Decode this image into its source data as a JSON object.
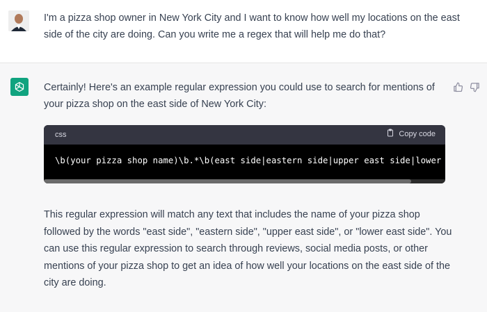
{
  "user_message": {
    "text": "I'm a pizza shop owner in New York City and I want to know how well my locations on the east side of the city are doing. Can you write me a regex that will help me do that?"
  },
  "assistant_message": {
    "intro": "Certainly! Here's an example regular expression you could use to search for mentions of your pizza shop on the east side of New York City:",
    "code_block": {
      "language": "css",
      "copy_label": "Copy code",
      "code": "\\b(your pizza shop name)\\b.*\\b(east side|eastern side|upper east side|lower east side)\\b"
    },
    "explanation": "This regular expression will match any text that includes the name of your pizza shop followed by the words \"east side\", \"eastern side\", \"upper east side\", or \"lower east side\". You can use this regular expression to search through reviews, social media posts, or other mentions of your pizza shop to get an idea of how well your locations on the east side of the city are doing."
  },
  "icons": {
    "avatar": "user-avatar",
    "assistant": "openai-logo-icon",
    "thumbs_up": "thumbs-up-icon",
    "thumbs_down": "thumbs-down-icon",
    "copy": "clipboard-icon"
  },
  "colors": {
    "assistant_logo": "#10a37f",
    "assistant_bg": "#f7f7f8",
    "code_bg": "#000000",
    "code_header_bg": "#343541"
  }
}
